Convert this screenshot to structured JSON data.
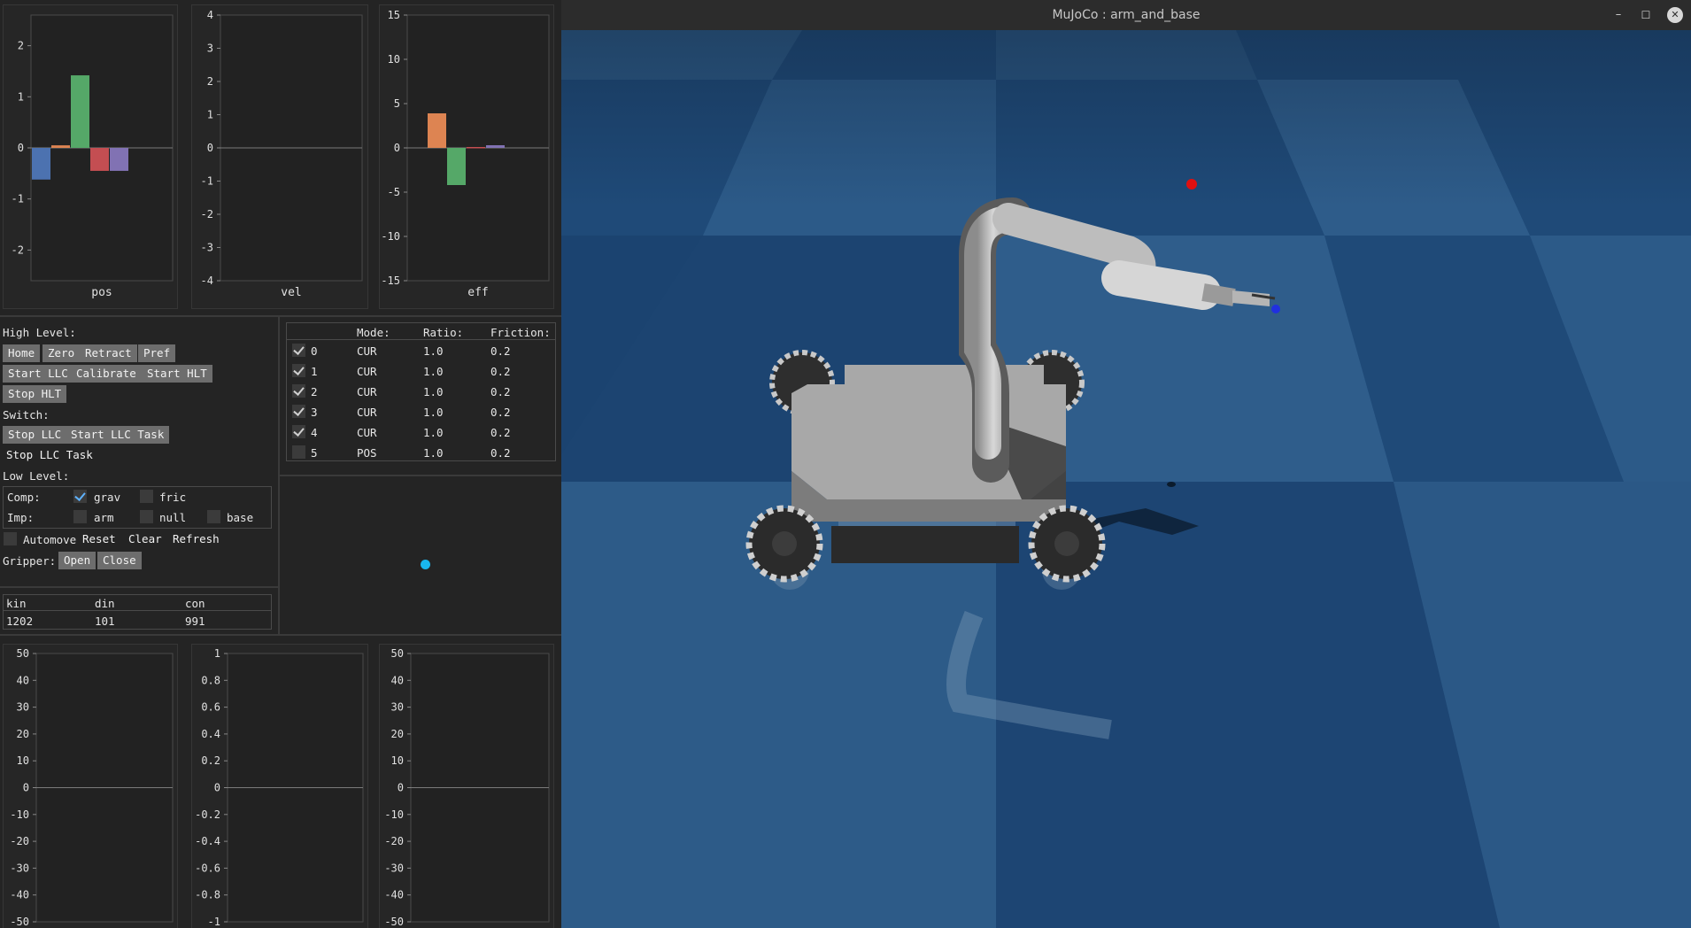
{
  "window": {
    "title": "MuJoCo : arm_and_base",
    "minimize": "–",
    "maximize": "☐",
    "close": "✕"
  },
  "top_charts": {
    "pos": {
      "label": "pos",
      "ticks": [
        "2",
        "1",
        "0",
        "-1",
        "-2"
      ]
    },
    "vel": {
      "label": "vel",
      "ticks": [
        "4",
        "3",
        "2",
        "1",
        "0",
        "-1",
        "-2",
        "-3",
        "-4"
      ]
    },
    "eff": {
      "label": "eff",
      "ticks": [
        "15",
        "10",
        "5",
        "0",
        "-5",
        "-10",
        "-15"
      ]
    }
  },
  "bottom_charts": {
    "left": {
      "ticks": [
        "50",
        "40",
        "30",
        "20",
        "10",
        "0",
        "-10",
        "-20",
        "-30",
        "-40",
        "-50"
      ]
    },
    "mid": {
      "ticks": [
        "1",
        "0.8",
        "0.6",
        "0.4",
        "0.2",
        "0",
        "-0.2",
        "-0.4",
        "-0.6",
        "-0.8",
        "-1"
      ]
    },
    "right": {
      "ticks": [
        "50",
        "40",
        "30",
        "20",
        "10",
        "0",
        "-10",
        "-20",
        "-30",
        "-40",
        "-50"
      ]
    }
  },
  "chart_data": [
    {
      "type": "bar",
      "xlabel": "pos",
      "ylim": [
        -2.6,
        2.6
      ],
      "values": [
        -0.62,
        0.05,
        1.42,
        -0.45,
        -0.45
      ],
      "colors": [
        "#4c72b0",
        "#dd8452",
        "#55a868",
        "#c44e52",
        "#8172b3"
      ]
    },
    {
      "type": "bar",
      "xlabel": "vel",
      "ylim": [
        -4,
        4
      ],
      "values": [
        0,
        0,
        0,
        0,
        0
      ]
    },
    {
      "type": "bar",
      "xlabel": "eff",
      "ylim": [
        -15,
        15
      ],
      "values": [
        3.9,
        -4.2,
        0.1,
        0.3
      ],
      "colors": [
        "#dd8452",
        "#55a868",
        "#c44e52",
        "#8172b3"
      ]
    }
  ],
  "controls": {
    "high_level": "High Level:",
    "buttons_row1": [
      "Home",
      "Zero",
      "Retract",
      "Pref"
    ],
    "buttons_row2": [
      "Start LLC",
      "Calibrate",
      "Start HLT"
    ],
    "buttons_row3": [
      "Stop HLT"
    ],
    "switch": "Switch:",
    "buttons_row4": [
      "Stop LLC",
      "Start LLC Task"
    ],
    "stop_llc_task": "Stop LLC Task",
    "low_level": "Low Level:",
    "comp_label": "Comp:",
    "grav": "grav",
    "fric": "fric",
    "imp_label": "Imp:",
    "arm": "arm",
    "null": "null",
    "base": "base",
    "automove": "Automove",
    "reset": "Reset",
    "clear": "Clear",
    "refresh": "Refresh",
    "gripper_label": "Gripper:",
    "open": "Open",
    "close": "Close"
  },
  "stats": {
    "headers": [
      "kin",
      "din",
      "con"
    ],
    "values": [
      "1202",
      "101",
      "991"
    ]
  },
  "joint_table": {
    "headers": [
      "Mode:",
      "Ratio:",
      "Friction:"
    ],
    "rows": [
      {
        "id": "0",
        "mode": "CUR",
        "ratio": "1.0",
        "friction": "0.2",
        "checked": true
      },
      {
        "id": "1",
        "mode": "CUR",
        "ratio": "1.0",
        "friction": "0.2",
        "checked": true
      },
      {
        "id": "2",
        "mode": "CUR",
        "ratio": "1.0",
        "friction": "0.2",
        "checked": true
      },
      {
        "id": "3",
        "mode": "CUR",
        "ratio": "1.0",
        "friction": "0.2",
        "checked": true
      },
      {
        "id": "4",
        "mode": "CUR",
        "ratio": "1.0",
        "friction": "0.2",
        "checked": true
      },
      {
        "id": "5",
        "mode": "POS",
        "ratio": "1.0",
        "friction": "0.2",
        "checked": false
      }
    ]
  },
  "colors": {
    "marker": "#19b6ee",
    "target_red": "#e01010",
    "target_blue": "#2030e0"
  }
}
